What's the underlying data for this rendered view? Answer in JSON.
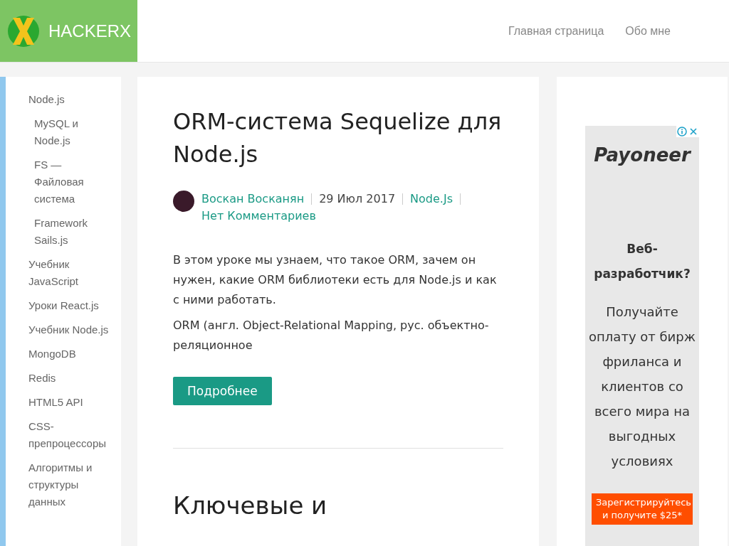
{
  "header": {
    "logo_text": "HACKERX",
    "nav": [
      "Главная страница",
      "Обо мне"
    ]
  },
  "sidebar": {
    "items": [
      {
        "label": "Node.js",
        "children": [
          {
            "label": "MySQL и Node.js"
          },
          {
            "label": "FS — Файловая система"
          },
          {
            "label": "Framework Sails.js"
          }
        ]
      },
      {
        "label": "Учебник JavaScript"
      },
      {
        "label": "Уроки React.js"
      },
      {
        "label": "Учебник Node.js"
      },
      {
        "label": "MongoDB"
      },
      {
        "label": "Redis"
      },
      {
        "label": "HTML5 API"
      },
      {
        "label": "CSS-препроцессоры"
      },
      {
        "label": "Алгоритмы и структуры данных"
      }
    ]
  },
  "post": {
    "title": "ORM-система Sequelize для Node.js",
    "author": "Воскан Восканян",
    "date": "29 Июл 2017",
    "category": "Node.Js",
    "comments": "Нет Комментариев",
    "paragraphs": [
      "В этом уроке мы узнаем, что такое ORM, зачем он нужен, какие ORM библиотеки есть для Node.js и как с ними работать.",
      "ORM (англ. Object-Relational Mapping, рус. объектно-реляционное"
    ],
    "button": "Подробнее"
  },
  "next_post": {
    "title": "Ключевые и"
  },
  "ad": {
    "brand": "Payoneer",
    "headline": "Веб-разработчик?",
    "body": "Получайте оплату от бирж фриланса и клиентов со всего мира на выгодных условиях",
    "cta": "Зарегистрируйтесь и получите $25*"
  }
}
